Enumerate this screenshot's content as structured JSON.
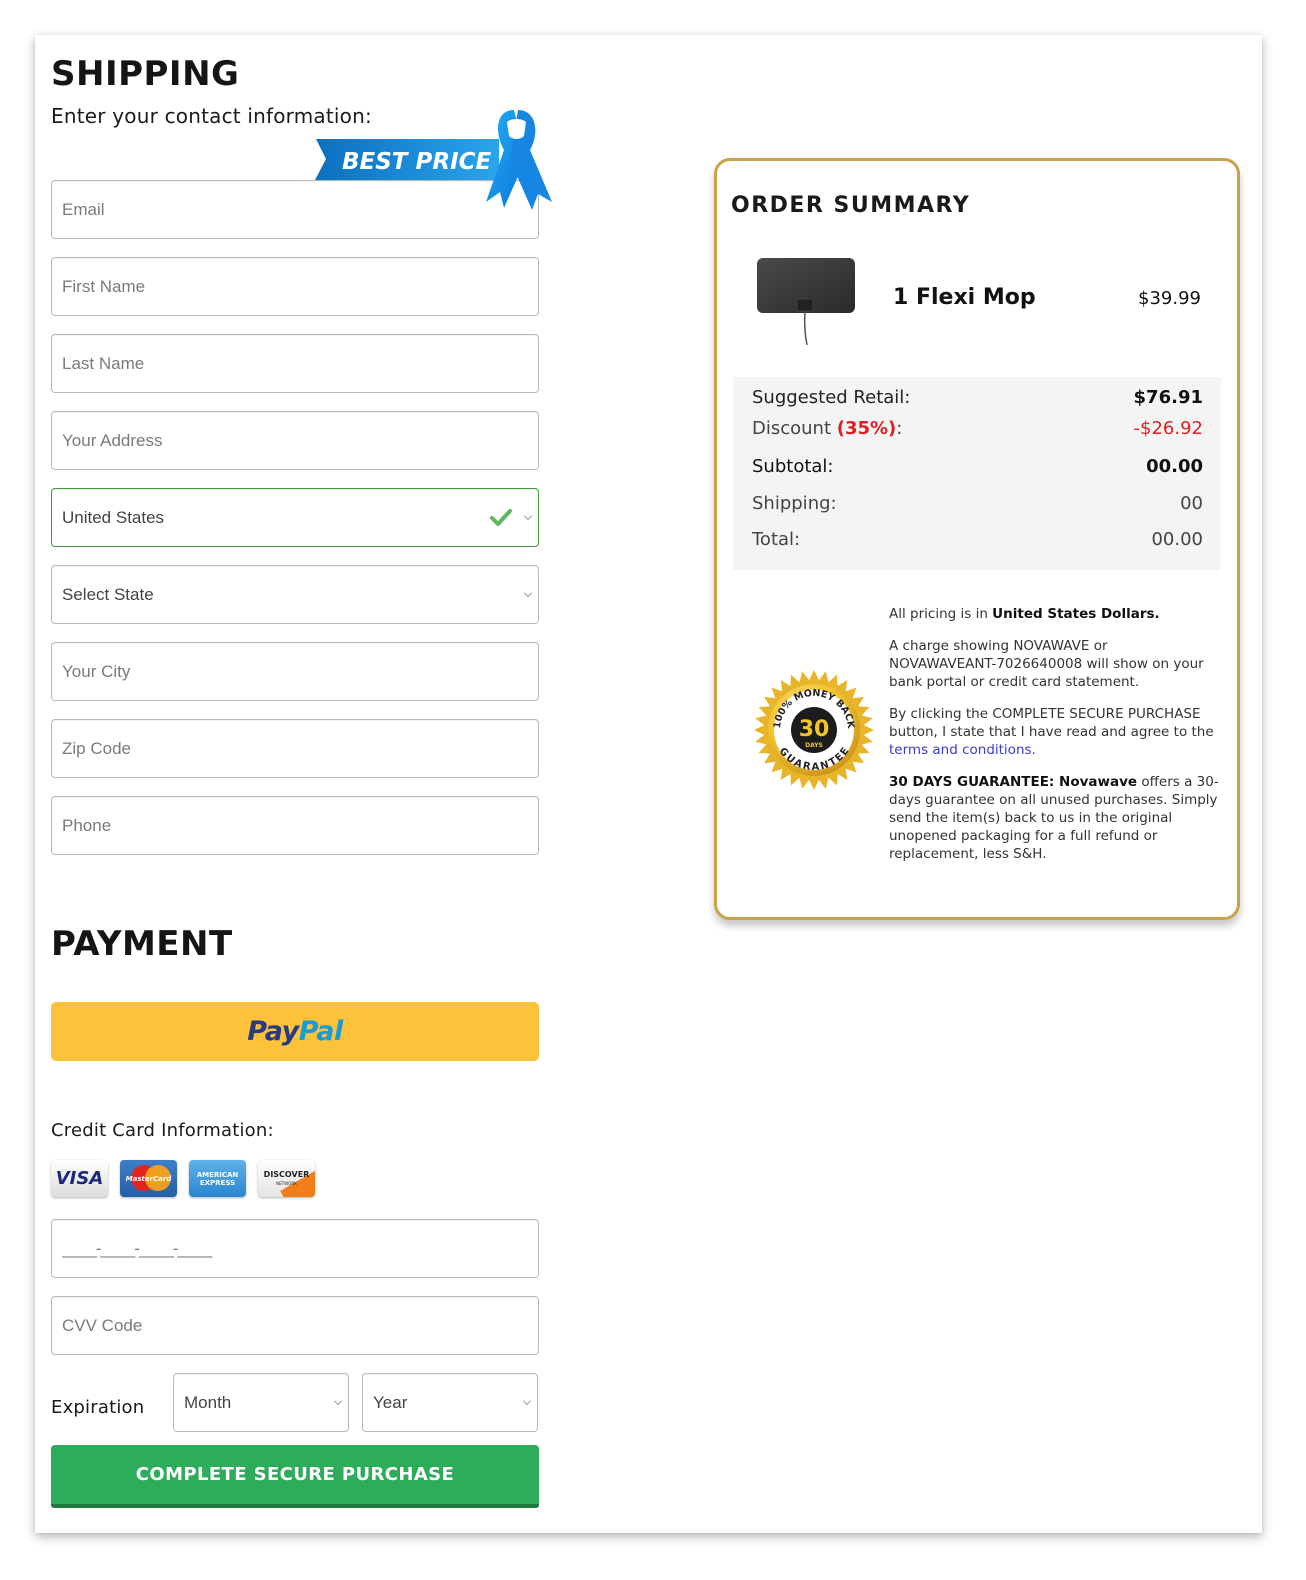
{
  "shipping": {
    "title": "SHIPPING",
    "subtitle": "Enter your contact information:",
    "badge": "BEST PRICE",
    "fields": {
      "email": {
        "placeholder": "Email",
        "value": ""
      },
      "first_name": {
        "placeholder": "First Name",
        "value": ""
      },
      "last_name": {
        "placeholder": "Last Name",
        "value": ""
      },
      "address": {
        "placeholder": "Your Address",
        "value": ""
      },
      "country": {
        "selected": "United States",
        "valid": true
      },
      "state": {
        "selected": "Select State"
      },
      "city": {
        "placeholder": "Your City",
        "value": ""
      },
      "zip": {
        "placeholder": "Zip Code",
        "value": ""
      },
      "phone": {
        "placeholder": "Phone",
        "value": ""
      }
    }
  },
  "payment": {
    "title": "PAYMENT",
    "paypal": {
      "part1": "Pay",
      "part2": "Pal"
    },
    "credit_card_label": "Credit Card Information:",
    "card_logos": [
      {
        "name": "visa-icon",
        "label": "VISA"
      },
      {
        "name": "mastercard-icon",
        "label": "MasterCard"
      },
      {
        "name": "amex-icon",
        "label": "AMERICAN EXPRESS"
      },
      {
        "name": "discover-icon",
        "label": "DISCOVER",
        "sub": "NETWORK"
      }
    ],
    "card_number": {
      "placeholder": "____-____-____-____",
      "value": ""
    },
    "cvv": {
      "placeholder": "CVV Code",
      "value": ""
    },
    "expiration_label": "Expiration",
    "month": {
      "selected": "Month"
    },
    "year": {
      "selected": "Year"
    },
    "submit_label": "COMPLETE SECURE PURCHASE"
  },
  "order_summary": {
    "title": "ORDER SUMMARY",
    "product": {
      "name": "1 Flexi Mop",
      "price": "$39.99"
    },
    "totals": {
      "retail_label": "Suggested Retail:",
      "retail_value": "$76.91",
      "discount_label": "Discount ",
      "discount_pct": "(35%)",
      "discount_colon": ":",
      "discount_value": "-$26.92",
      "subtotal_label": "Subtotal:",
      "subtotal_value": "00.00",
      "shipping_label": "Shipping:",
      "shipping_value": "00",
      "total_label": "Total:",
      "total_value": "00.00"
    },
    "seal": {
      "top": "100% MONEY BACK",
      "number": "30",
      "days": "DAYS",
      "bottom": "GUARANTEE"
    },
    "notes": {
      "currency_prefix": "All pricing is in ",
      "currency_bold": "United States Dollars.",
      "charge_text": "A charge showing NOVAWAVE or NOVAWAVEANT-7026640008 will show on your bank portal or credit card statement.",
      "agree_text": "By clicking the COMPLETE SECURE PURCHASE button, I state that I have read and agree to the ",
      "terms_link": "terms and conditions.",
      "guarantee_bold": "30 DAYS GUARANTEE: Novawave",
      "guarantee_text": " offers a 30-days guarantee on all unused purchases. Simply send the item(s) back to us in the original unopened packaging for a full refund or replacement, less S&H."
    }
  },
  "colors": {
    "accent_green": "#2dac5b",
    "paypal_yellow": "#fec23a",
    "summary_border_gold": "#c9a24a",
    "discount_red": "#e02020",
    "link_blue": "#3a3ad6"
  }
}
